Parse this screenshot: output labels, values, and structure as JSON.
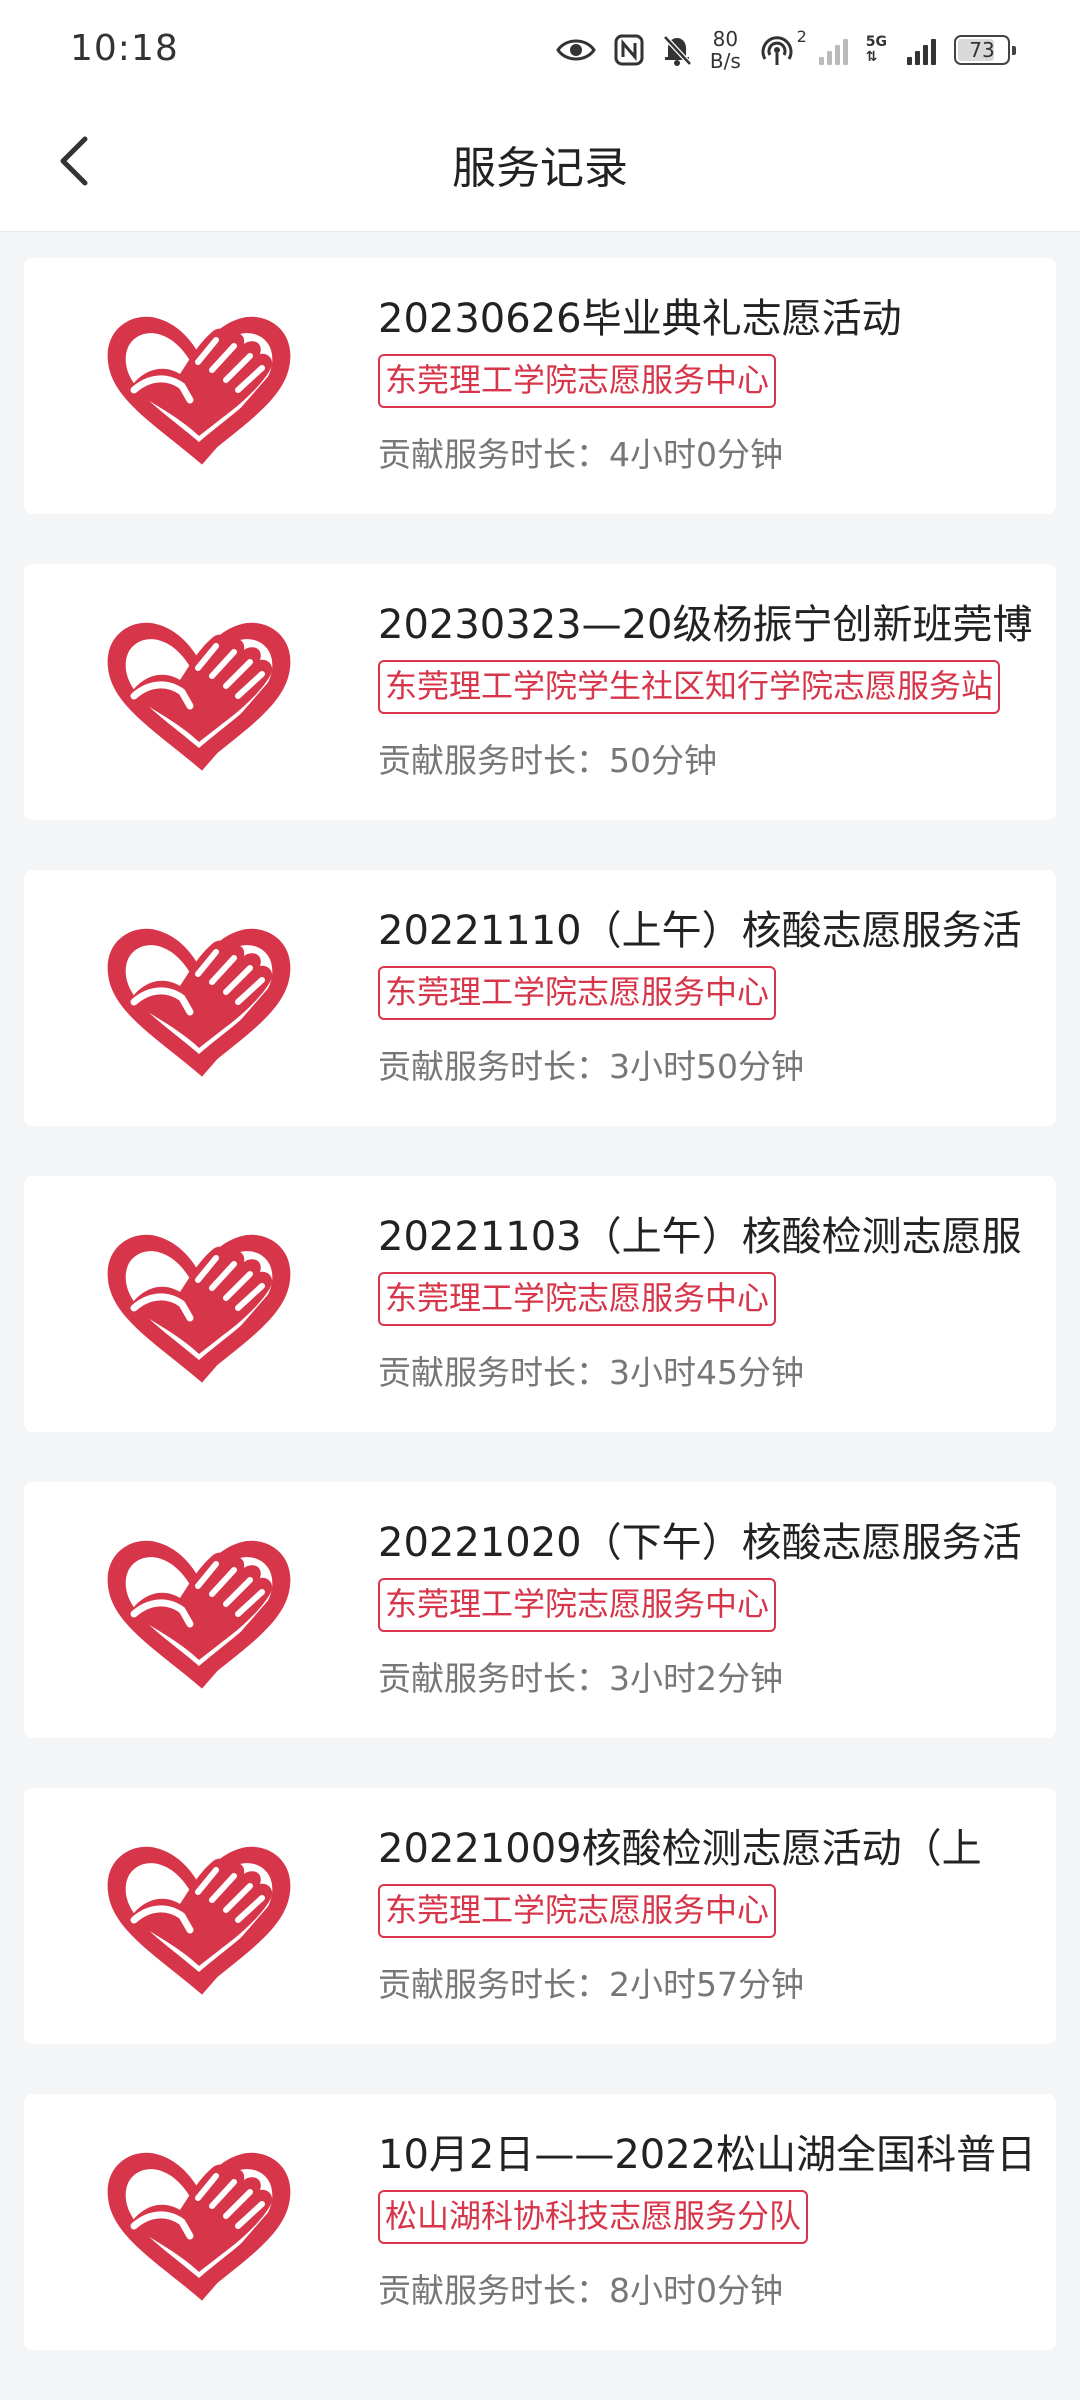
{
  "status_bar": {
    "time": "10:18",
    "net_speed_value": "80",
    "net_speed_unit": "B/s",
    "hotspot_count": "2",
    "network_type": "5G",
    "battery": "73",
    "icons": [
      "eye-icon",
      "nfc-icon",
      "bell-off-icon",
      "hotspot-icon",
      "signal-icon",
      "battery-icon"
    ]
  },
  "header": {
    "title": "服务记录",
    "back_icon": "chevron-left-icon"
  },
  "colors": {
    "accent_red": "#d7354a",
    "background": "#f3f5f7",
    "card": "#ffffff"
  },
  "records": [
    {
      "title": "20230626毕业典礼志愿活动",
      "org": "东莞理工学院志愿服务中心",
      "duration_label": "贡献服务时长：",
      "duration": "4小时0分钟"
    },
    {
      "title": "20230323—20级杨振宁创新班莞博",
      "org": "东莞理工学院学生社区知行学院志愿服务站",
      "duration_label": "贡献服务时长：",
      "duration": "50分钟"
    },
    {
      "title": "20221110（上午）核酸志愿服务活",
      "org": "东莞理工学院志愿服务中心",
      "duration_label": "贡献服务时长：",
      "duration": "3小时50分钟"
    },
    {
      "title": "20221103（上午）核酸检测志愿服",
      "org": "东莞理工学院志愿服务中心",
      "duration_label": "贡献服务时长：",
      "duration": "3小时45分钟"
    },
    {
      "title": "20221020（下午）核酸志愿服务活",
      "org": "东莞理工学院志愿服务中心",
      "duration_label": "贡献服务时长：",
      "duration": "3小时2分钟"
    },
    {
      "title": "20221009核酸检测志愿活动（上",
      "org": "东莞理工学院志愿服务中心",
      "duration_label": "贡献服务时长：",
      "duration": "2小时57分钟"
    },
    {
      "title": "10月2日——2022松山湖全国科普日",
      "org": "松山湖科协科技志愿服务分队",
      "duration_label": "贡献服务时长：",
      "duration": "8小时0分钟"
    }
  ]
}
